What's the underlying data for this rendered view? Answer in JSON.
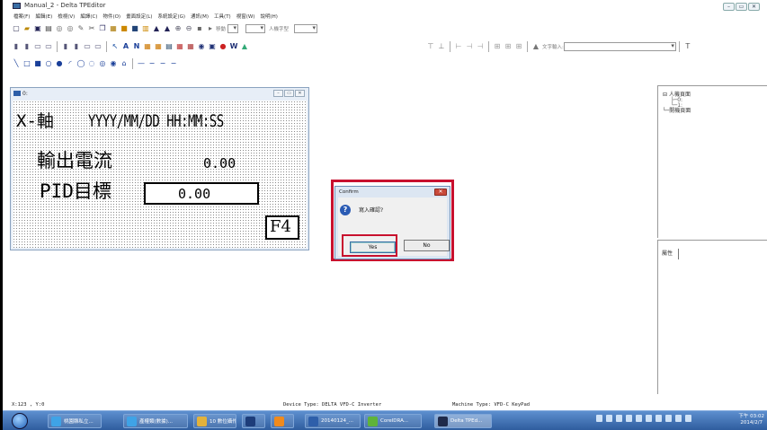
{
  "app": {
    "title": "Manual_2 - Delta TPEditor"
  },
  "menu": [
    "檔案(F)",
    "編輯(E)",
    "檢視(V)",
    "編譯(C)",
    "物件(O)",
    "畫面設定(L)",
    "系統設定(G)",
    "通訊(M)",
    "工具(T)",
    "視窗(W)",
    "說明(H)"
  ],
  "toolbar": {
    "size_label": "移動",
    "font_label": "人機字型",
    "text_input_label": "文字輸入:"
  },
  "screen_window": {
    "title": "0:",
    "lines": {
      "header_axis": "X-軸",
      "header_datetime": "YYYY/MM/DD HH:MM:SS",
      "output_current_label": "輸出電流",
      "output_current_value": "0.00",
      "pid_label": "PID目標",
      "pid_value": "0.00",
      "fkey": "F4"
    }
  },
  "tree": {
    "root": "人機頁面",
    "child_0": "0:",
    "child_1": "1:",
    "second": "開機頁面"
  },
  "props": {
    "tab": "屬性"
  },
  "dialog": {
    "title": "Confirm",
    "message": "寫入確認?",
    "yes": "Yes",
    "no": "No",
    "close": "✕"
  },
  "status": {
    "coords": "X:123 , Y:0",
    "device": "Device Type: DELTA VFD-C Inverter",
    "machine": "Machine Type: VFD-C KeyPad"
  },
  "taskbar": {
    "items": [
      "桃園縣私立...",
      "產權類(數據)...",
      "10 數位攝作...",
      "",
      "",
      "20140124_...",
      "CorelDRA...",
      "Delta TPEd..."
    ],
    "clock_time": "下午 03:02",
    "clock_date": "2014/2/7"
  },
  "colors": {
    "highlight": "#c8102e",
    "taskbar": "#2f5d9e"
  }
}
